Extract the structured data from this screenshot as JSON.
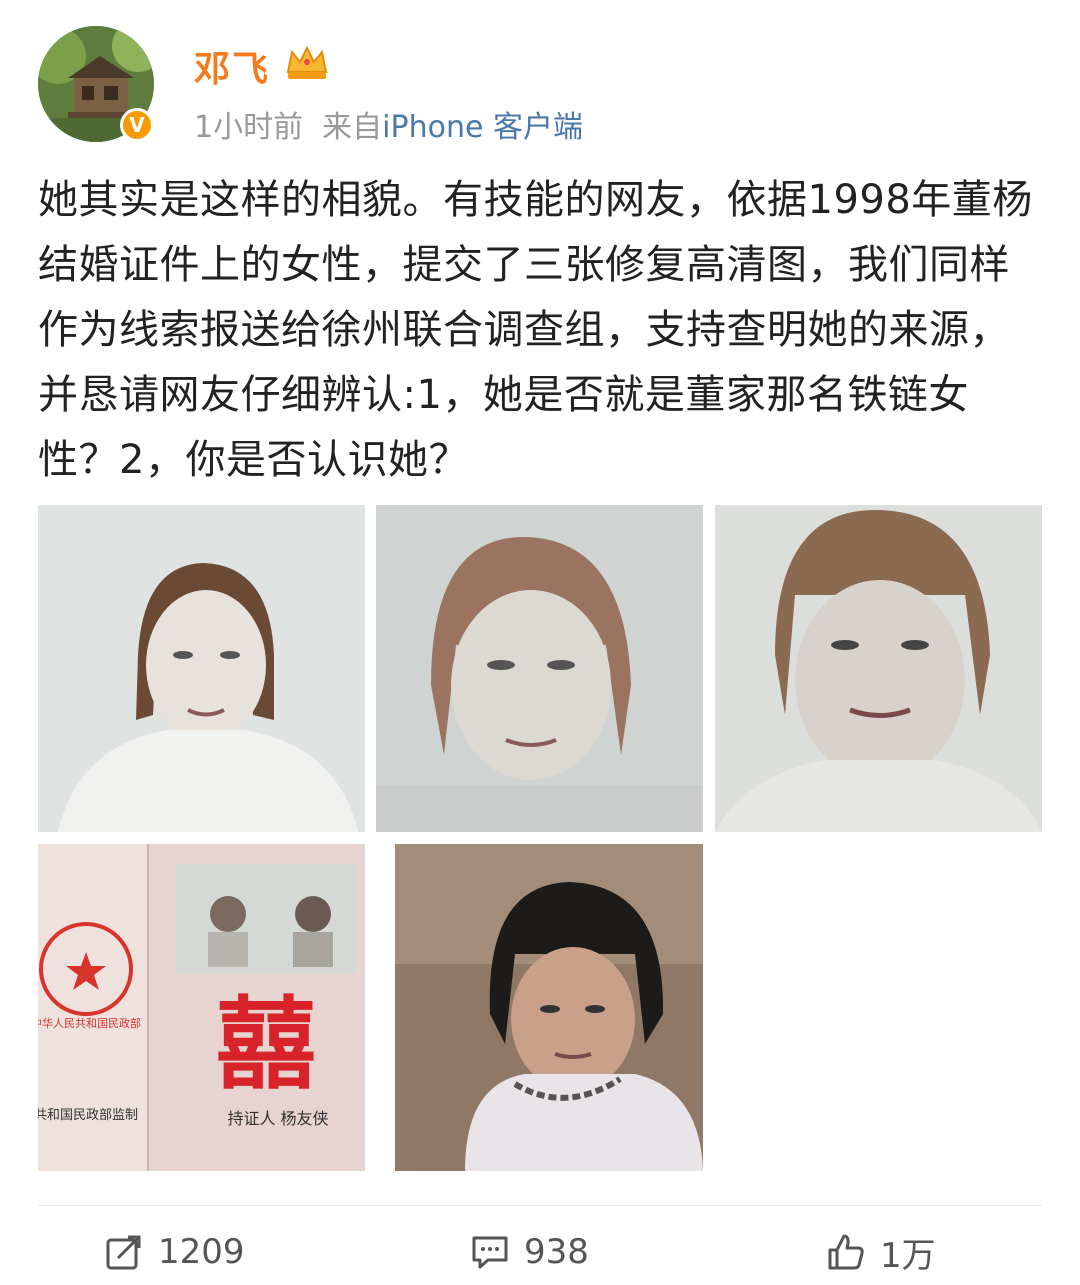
{
  "post": {
    "author": "邓飞",
    "time": "1小时前",
    "source_prefix": "来自",
    "source_client": "iPhone 客户端",
    "verified_badge": "V",
    "text": "她其实是这样的相貌。有技能的网友，依据1998年董杨结婚证件上的女性，提交了三张修复高清图，我们同样作为线索报送给徐州联合调查组，支持查明她的来源，并恳请网友仔细辨认:1，她是否就是董家那名铁链女性？2，你是否认识她？"
  },
  "images": [
    {
      "alt": "修复照片1"
    },
    {
      "alt": "修复照片2"
    },
    {
      "alt": "修复照片3"
    },
    {
      "alt": "结婚证件",
      "char": "囍",
      "seal_text": "中华人民共和国民政部",
      "caption_left": "共和国民政部监制",
      "caption_right": "持证人 杨友侠"
    },
    {
      "alt": "铁链女性照片"
    }
  ],
  "actions": {
    "repost": {
      "icon": "repost-icon",
      "count": "1209"
    },
    "comment": {
      "icon": "comment-icon",
      "count": "938"
    },
    "like": {
      "icon": "like-icon",
      "count": "1万"
    }
  },
  "colors": {
    "name": "#f37b1d",
    "client_link": "#4a78a8",
    "meta": "#999999",
    "badge": "#f59a00"
  }
}
